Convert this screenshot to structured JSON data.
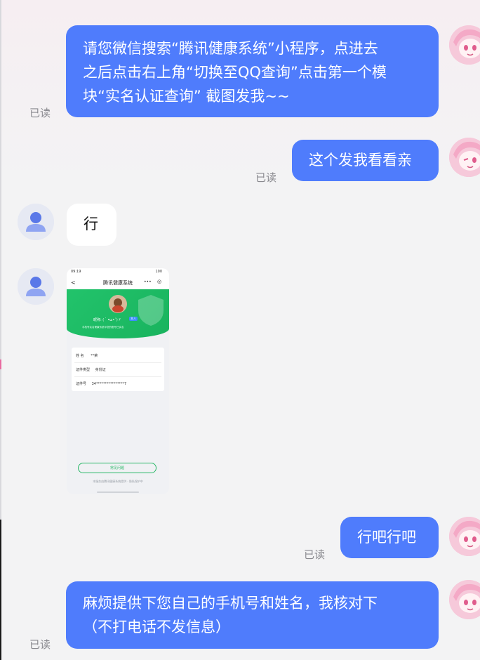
{
  "colors": {
    "outgoing_bubble": "#4f7cfc",
    "incoming_bubble": "#ffffff",
    "background": "#f3f3f4",
    "read_status": "#8a8a8f",
    "mini_app_green": "#22c36b"
  },
  "icons": {
    "me_avatar": "anime-girl-pink-hair-avatar",
    "other_avatar": "default-person-avatar"
  },
  "messages": [
    {
      "direction": "outgoing",
      "text": "请您微信搜索“腾讯健康系统”小程序，点进去\n之后点击右上角“切换至QQ查询”点击第一个模\n块“实名认证查询” 截图发我~~",
      "status": "已读"
    },
    {
      "direction": "outgoing",
      "text": "这个发我看看亲",
      "status": "已读"
    },
    {
      "direction": "incoming",
      "text": "行"
    },
    {
      "direction": "incoming",
      "type": "image",
      "screenshot": {
        "status_time": "09:19",
        "status_right": "100",
        "nav_back": "<",
        "nav_title": "腾讯健康系统",
        "nav_more": "•••",
        "nav_close": "◎",
        "user_name": "昵称: (｀•ω•´)ゞ",
        "user_badge": "本人",
        "user_sub": "手机号实名健康系统中您的账号已实名",
        "rows": [
          {
            "label": "姓  名",
            "value": "**荣"
          },
          {
            "label": "证件类型",
            "value": "身份证"
          },
          {
            "label": "证件号",
            "value": "34****************7"
          }
        ],
        "feedback_label": "常见问题",
        "footer_note": "本服务由腾讯健康系统提供 · 隐私保护中"
      }
    },
    {
      "direction": "outgoing",
      "text": "行吧行吧",
      "status": "已读"
    },
    {
      "direction": "outgoing",
      "text": "麻烦提供下您自己的手机号和姓名，我核对下\n（不打电话不发信息）",
      "status": "已读"
    }
  ]
}
